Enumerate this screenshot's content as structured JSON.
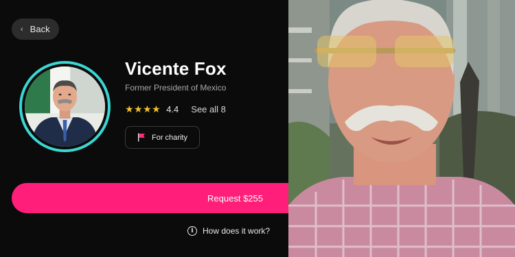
{
  "header": {
    "back_label": "Back"
  },
  "profile": {
    "name": "Vicente Fox",
    "subtitle": "Former President of Mexico",
    "rating": {
      "stars": "★★★★",
      "value": "4.4",
      "see_all": "See all 8"
    },
    "chip": {
      "label": "For charity",
      "icon": "flag-icon"
    }
  },
  "actions": {
    "request_label": "Request $255",
    "how_label": "How does it work?"
  },
  "colors": {
    "accent": "#ff1f7a",
    "ring": "#3ad7d3",
    "star": "#f2c230",
    "background": "#0b0b0b"
  }
}
